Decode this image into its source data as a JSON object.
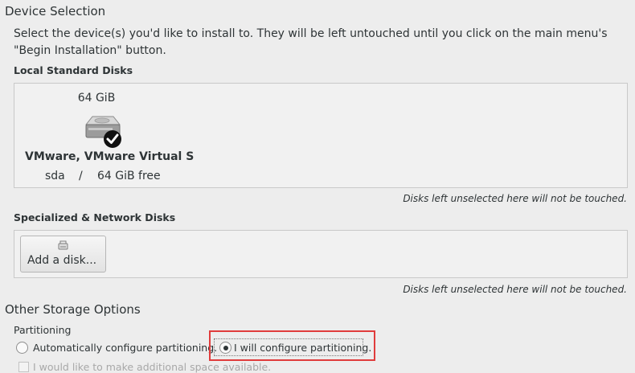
{
  "device_selection": {
    "title": "Device Selection",
    "intro_line1": "Select the device(s) you'd like to install to.  They will be left untouched until you click on the main menu's",
    "intro_line2": "\"Begin Installation\" button."
  },
  "local_disks": {
    "heading": "Local Standard Disks",
    "disk": {
      "size": "64 GiB",
      "name": "VMware, VMware Virtual S",
      "device": "sda",
      "separator": "/",
      "free": "64 GiB free",
      "icon": "hard-disk-icon",
      "selected": true
    },
    "note": "Disks left unselected here will not be touched."
  },
  "network_disks": {
    "heading": "Specialized & Network Disks",
    "add_button_label": "Add a disk...",
    "add_button_icon": "network-disk-icon",
    "note": "Disks left unselected here will not be touched."
  },
  "other_storage": {
    "title": "Other Storage Options",
    "partitioning_heading": "Partitioning",
    "auto_option": "Automatically configure partitioning.",
    "manual_option": "I will configure partitioning.",
    "selected_option": "manual",
    "additional_space_option": "I would like to make additional space available.",
    "highlight_color": "#e03c3c"
  }
}
